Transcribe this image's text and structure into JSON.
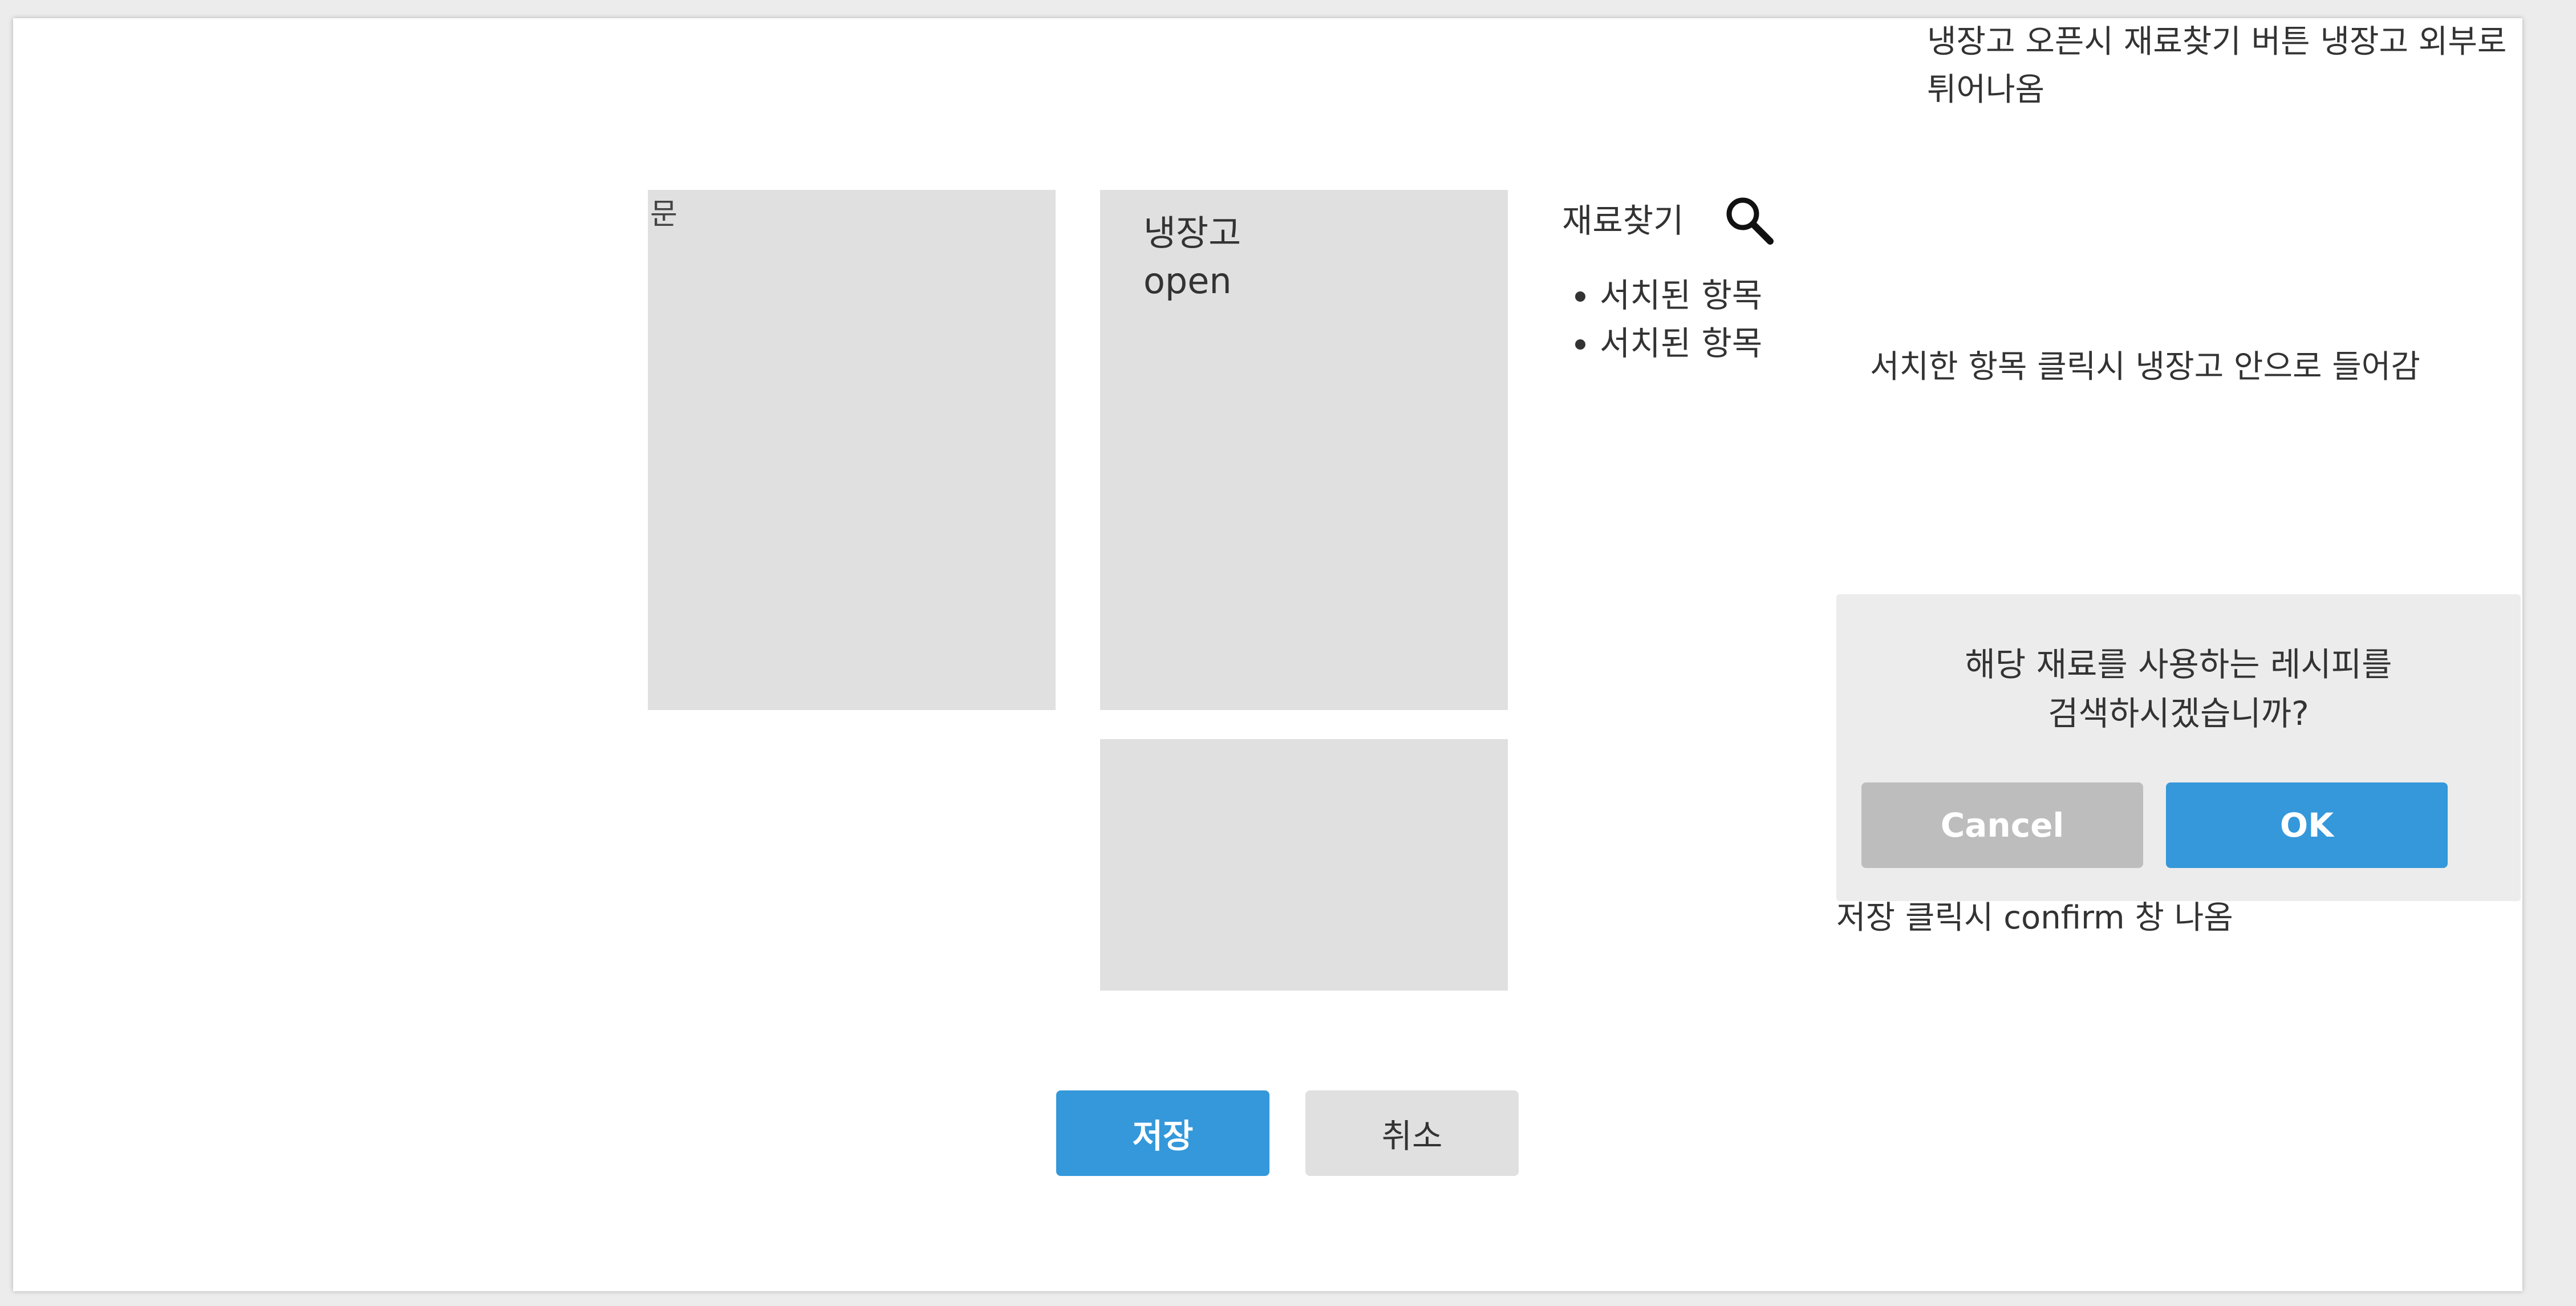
{
  "annotations": {
    "top_right_line1": "냉장고 오픈시 재료찾기 버튼 냉장고 외부로",
    "top_right_line2": "튀어나옴",
    "search_click": "서치한 항목 클릭시 냉장고 안으로 들어감",
    "save_confirm": "저장 클릭시 confirm 창 나옴"
  },
  "door": {
    "label": "문"
  },
  "fridge": {
    "label_line1": "냉장고",
    "label_line2": "open"
  },
  "search": {
    "label": "재료찾기",
    "icon": "search-icon",
    "results": [
      "서치된 항목",
      "서치된 항목"
    ]
  },
  "dialog": {
    "message_line1": "해당 재료를 사용하는 레시피를",
    "message_line2": "검색하시겠습니까?",
    "cancel_label": "Cancel",
    "ok_label": "OK"
  },
  "actions": {
    "save_label": "저장",
    "cancel_label": "취소"
  },
  "colors": {
    "primary": "#3498db",
    "panel": "#e0e0e0",
    "dialog_bg": "#ececec",
    "cancel_grey": "#bdbdbd"
  }
}
